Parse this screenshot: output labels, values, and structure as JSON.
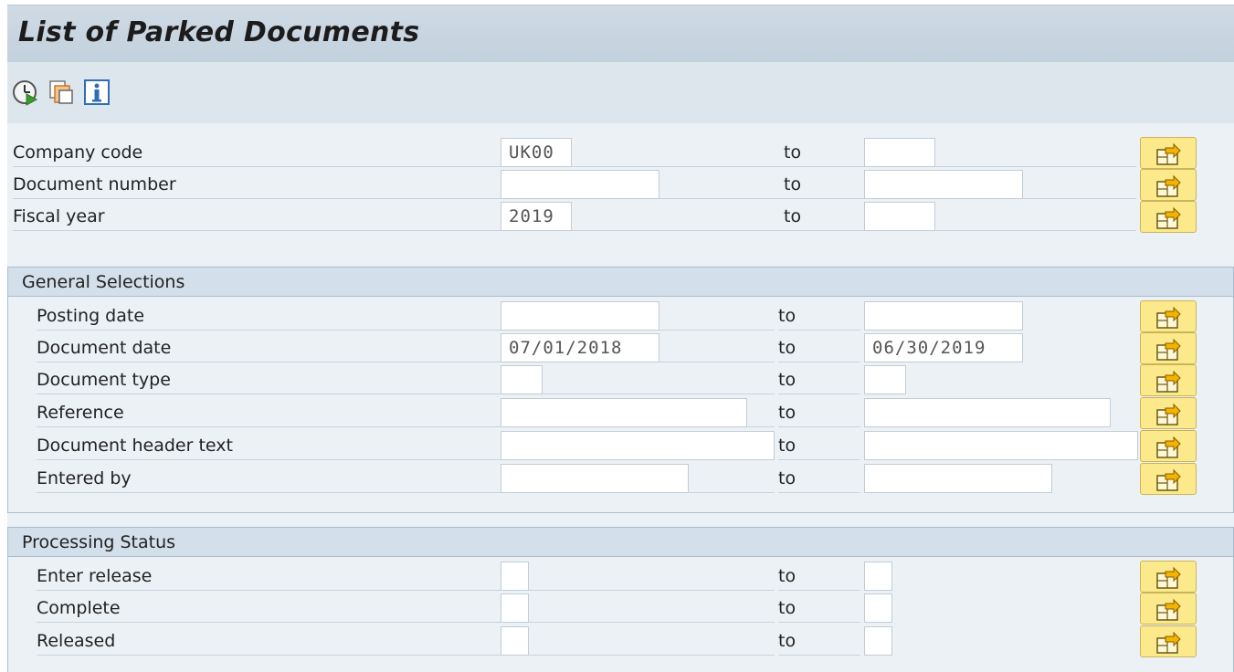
{
  "title": "List of Parked Documents",
  "toolbar": {
    "buttons": [
      {
        "name": "execute-icon"
      },
      {
        "name": "get-variant-icon"
      },
      {
        "name": "info-icon"
      }
    ]
  },
  "to_label": "to",
  "top_fields": {
    "company_code": {
      "label": "Company code",
      "low": "UK00",
      "high": ""
    },
    "document_number": {
      "label": "Document number",
      "low": "",
      "high": ""
    },
    "fiscal_year": {
      "label": "Fiscal year",
      "low": "2019",
      "high": ""
    }
  },
  "general_selections": {
    "title": "General Selections",
    "posting_date": {
      "label": "Posting date",
      "low": "",
      "high": ""
    },
    "document_date": {
      "label": "Document date",
      "low": "07/01/2018",
      "high": "06/30/2019"
    },
    "document_type": {
      "label": "Document type",
      "low": "",
      "high": ""
    },
    "reference": {
      "label": "Reference",
      "low": "",
      "high": ""
    },
    "header_text": {
      "label": "Document header text",
      "low": "",
      "high": ""
    },
    "entered_by": {
      "label": "Entered by",
      "low": "",
      "high": ""
    }
  },
  "processing_status": {
    "title": "Processing Status",
    "enter_release": {
      "label": "Enter release",
      "low": "",
      "high": ""
    },
    "complete": {
      "label": "Complete",
      "low": "",
      "high": ""
    },
    "released": {
      "label": "Released",
      "low": "",
      "high": ""
    }
  },
  "colors": {
    "header_bg": "#c3d1de",
    "toolbar_bg": "#dde5ed",
    "body_bg": "#ecf1f6",
    "multi_btn": "#fbe98c"
  }
}
